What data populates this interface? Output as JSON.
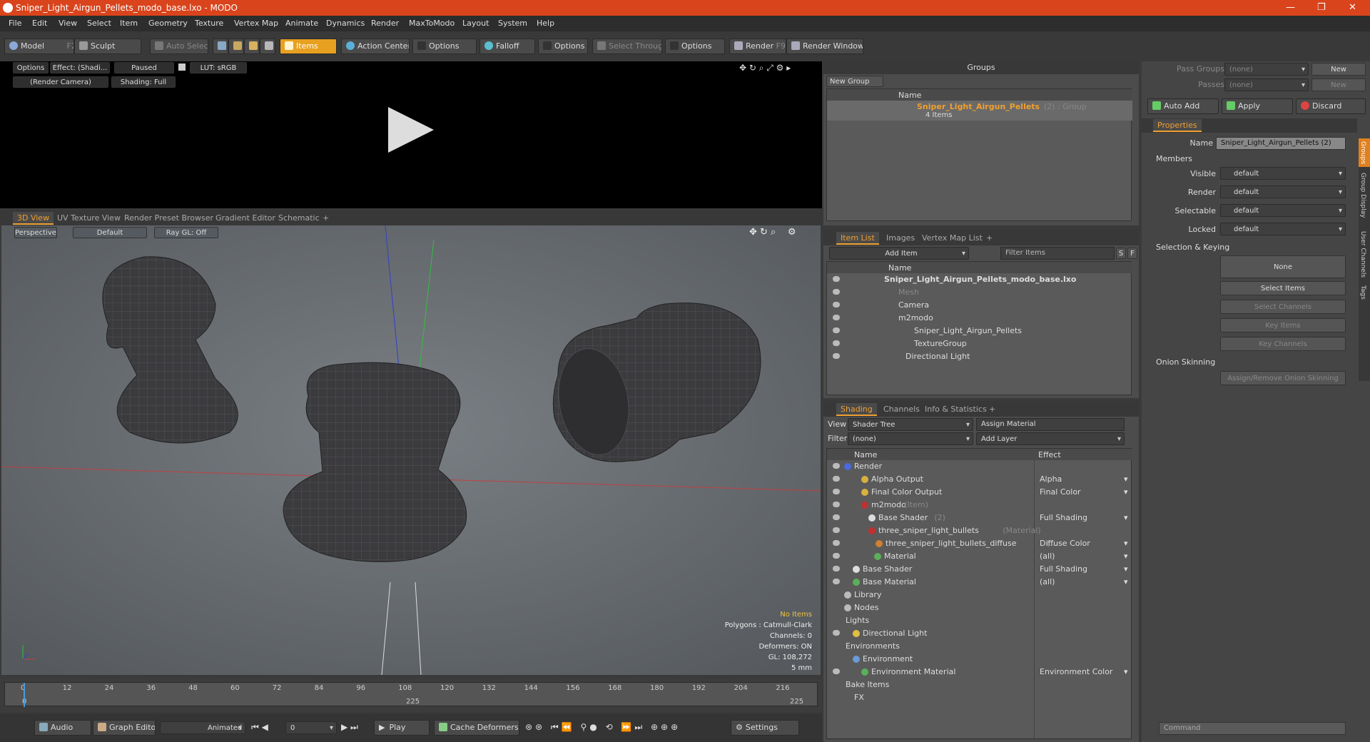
{
  "window": {
    "title": "Sniper_Light_Airgun_Pellets_modo_base.lxo - MODO"
  },
  "menu": [
    "File",
    "Edit",
    "View",
    "Select",
    "Item",
    "Geometry",
    "Texture",
    "Vertex Map",
    "Animate",
    "Dynamics",
    "Render",
    "MaxToModo",
    "Layout",
    "System",
    "Help"
  ],
  "toolbar": {
    "model": "Model",
    "model_key": "F2",
    "sculpt": "Sculpt",
    "auto_select": "Auto Select",
    "items": "Items",
    "action_center": "Action Center",
    "options1": "Options",
    "falloff": "Falloff",
    "options2": "Options",
    "select_through": "Select Through",
    "options3": "Options",
    "render": "Render",
    "render_key": "F9",
    "render_window": "Render Window"
  },
  "preview": {
    "options": "Options",
    "effect": "Effect: (Shadi...",
    "paused": "Paused",
    "lut": "LUT: sRGB",
    "camera": "(Render Camera)",
    "shading": "Shading: Full"
  },
  "viewport_tabs": [
    "3D View",
    "UV Texture View",
    "Render Preset Browser",
    "Gradient Editor",
    "Schematic",
    "+"
  ],
  "viewport": {
    "perspective": "Perspective",
    "default": "Default",
    "raygl": "Ray GL: Off",
    "info": {
      "no_items": "No Items",
      "polygons": "Polygons : Catmull-Clark",
      "channels": "Channels: 0",
      "deformers": "Deformers: ON",
      "gl": "GL: 108,272",
      "scale": "5 mm"
    }
  },
  "timeline": {
    "ticks": [
      "0",
      "12",
      "24",
      "36",
      "48",
      "60",
      "72",
      "84",
      "96",
      "108",
      "120",
      "132",
      "144",
      "156",
      "168",
      "180",
      "192",
      "204",
      "216"
    ],
    "start": "0",
    "mid": "225",
    "end": "225"
  },
  "bottombar": {
    "audio": "Audio",
    "graph_editor": "Graph Editor",
    "animated": "Animated",
    "frame": "0",
    "play": "Play",
    "cache": "Cache Deformers",
    "settings": "Settings"
  },
  "groups": {
    "title": "Groups",
    "new_group": "New Group",
    "col_name": "Name",
    "item_name": "Sniper_Light_Airgun_Pellets",
    "item_suffix": "(2) : Group",
    "item_count": "4 Items"
  },
  "itemlist": {
    "tabs": [
      "Item List",
      "Images",
      "Vertex Map List",
      "+"
    ],
    "add_item": "Add Item",
    "filter": "Filter Items",
    "s": "S",
    "f": "F",
    "col_name": "Name",
    "rows": [
      {
        "label": "Sniper_Light_Airgun_Pellets_modo_base.lxo",
        "style": "bold"
      },
      {
        "label": "Mesh",
        "style": "gray"
      },
      {
        "label": "Camera",
        "style": ""
      },
      {
        "label": "m2modo",
        "style": ""
      },
      {
        "label": "Sniper_Light_Airgun_Pellets",
        "style": ""
      },
      {
        "label": "TextureGroup",
        "style": ""
      },
      {
        "label": "Directional Light",
        "style": ""
      }
    ]
  },
  "shading": {
    "tabs": [
      "Shading",
      "Channels",
      "Info & Statistics",
      "+"
    ],
    "view_label": "View",
    "view_value": "Shader Tree",
    "assign": "Assign Material",
    "filter_label": "Filter",
    "filter_value": "(none)",
    "add_layer": "Add Layer",
    "col_name": "Name",
    "col_effect": "Effect",
    "rows": [
      {
        "name": "Render",
        "suffix": "",
        "effect": ""
      },
      {
        "name": "Alpha Output",
        "suffix": "",
        "effect": "Alpha"
      },
      {
        "name": "Final Color Output",
        "suffix": "",
        "effect": "Final Color"
      },
      {
        "name": "m2modo",
        "suffix": "(Item)",
        "effect": ""
      },
      {
        "name": "Base Shader",
        "suffix": "(2)",
        "effect": "Full Shading"
      },
      {
        "name": "three_sniper_light_bullets",
        "suffix": "(Material)",
        "effect": ""
      },
      {
        "name": "three_sniper_light_bullets_diffuse",
        "suffix": "(...",
        "effect": "Diffuse Color"
      },
      {
        "name": "Material",
        "suffix": "",
        "effect": "(all)"
      },
      {
        "name": "Base Shader",
        "suffix": "",
        "effect": "Full Shading"
      },
      {
        "name": "Base Material",
        "suffix": "",
        "effect": "(all)"
      },
      {
        "name": "Library",
        "suffix": "",
        "effect": ""
      },
      {
        "name": "Nodes",
        "suffix": "",
        "effect": ""
      },
      {
        "name": "Lights",
        "suffix": "",
        "effect": ""
      },
      {
        "name": "Directional Light",
        "suffix": "",
        "effect": ""
      },
      {
        "name": "Environments",
        "suffix": "",
        "effect": ""
      },
      {
        "name": "Environment",
        "suffix": "",
        "effect": ""
      },
      {
        "name": "Environment Material",
        "suffix": "",
        "effect": "Environment Color"
      },
      {
        "name": "Bake Items",
        "suffix": "",
        "effect": ""
      },
      {
        "name": "FX",
        "suffix": "",
        "effect": ""
      }
    ]
  },
  "props": {
    "pass_groups": "Pass Groups",
    "passes": "Passes",
    "none": "(none)",
    "new": "New",
    "auto_add": "Auto Add",
    "apply": "Apply",
    "discard": "Discard",
    "tab": "Properties",
    "name_label": "Name",
    "name_value": "Sniper_Light_Airgun_Pellets (2)",
    "members": "Members",
    "fields": [
      {
        "label": "Visible",
        "value": "default"
      },
      {
        "label": "Render",
        "value": "default"
      },
      {
        "label": "Selectable",
        "value": "default"
      },
      {
        "label": "Locked",
        "value": "default"
      }
    ],
    "sel_keying": "Selection & Keying",
    "none_btn": "None",
    "select_items": "Select Items",
    "select_channels": "Select Channels",
    "key_items": "Key Items",
    "key_channels": "Key Channels",
    "onion": "Onion Skinning",
    "assign_onion": "Assign/Remove Onion Skinning",
    "command": "Command",
    "side_tabs": [
      "Groups",
      "Group Display",
      "User Channels",
      "Tags"
    ]
  }
}
